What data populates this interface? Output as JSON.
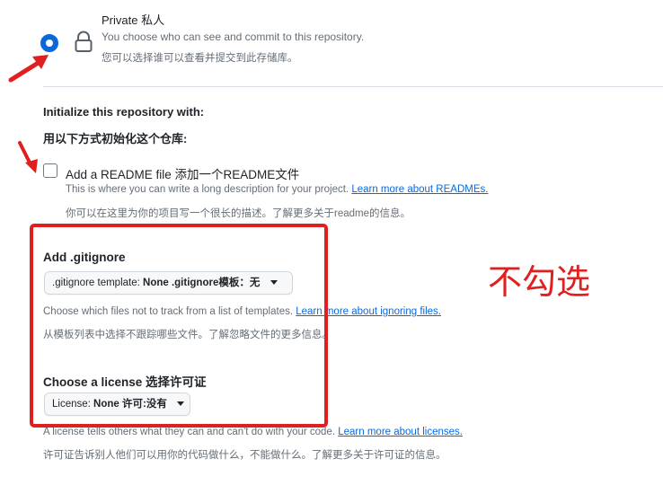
{
  "visibility": {
    "private_title": "Private 私人",
    "private_desc": "You choose who can see and commit to this repository.",
    "private_desc_cn": "您可以选择谁可以查看并提交到此存储库。",
    "selected": true
  },
  "initialize": {
    "title": "Initialize this repository with:",
    "title_cn": "用以下方式初始化这个仓库:",
    "readme": {
      "label": "Add a README file 添加一个README文件",
      "checked": false,
      "desc": "This is where you can write a long description for your project.",
      "link": "Learn more about READMEs.",
      "desc_cn": "你可以在这里为你的项目写一个很长的描述。了解更多关于readme的信息。"
    }
  },
  "gitignore": {
    "title": "Add .gitignore",
    "select_label": ".gitignore template:",
    "select_value": "None .gitignore模板：无",
    "desc": "Choose which files not to track from a list of templates.",
    "link": "Learn more about ignoring files.",
    "desc_cn": "从模板列表中选择不跟踪哪些文件。了解忽略文件的更多信息。"
  },
  "license": {
    "title": "Choose a license 选择许可证",
    "select_label": "License:",
    "select_value": "None 许可:没有",
    "desc": "A license tells others what they can and can't do with your code.",
    "link": "Learn more about licenses.",
    "desc_cn": "许可证告诉别人他们可以用你的代码做什么，不能做什么。了解更多关于许可证的信息。"
  },
  "annotation": {
    "text": "不勾选",
    "color": "#e02020"
  },
  "colors": {
    "accent": "#0969da",
    "muted": "#656d76",
    "text": "#1f2328"
  },
  "icons": [
    "lock-icon",
    "caret-down-icon",
    "red-arrow-icon"
  ]
}
